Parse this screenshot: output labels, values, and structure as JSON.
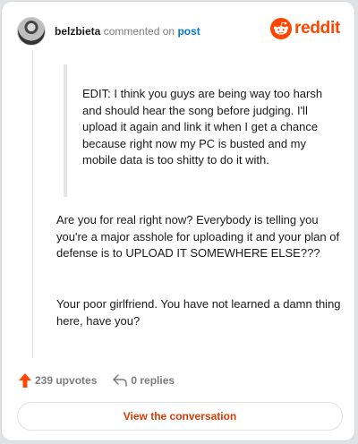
{
  "comment": {
    "author": "belzbieta",
    "action": "commented on",
    "target": "post",
    "quoted_text": "EDIT: I think you guys are being way too harsh and should hear the song before judging. I'll upload it again and link it when I get a chance because right now my PC is busted and my mobile data is too shitty to do it with.",
    "paragraphs": [
      "Are you for real right now? Everybody is telling you you're a major asshole for uploading it and your plan of defense is to UPLOAD IT SOMEWHERE ELSE???",
      "Your poor girlfriend. You have not learned a damn thing here, have you?"
    ]
  },
  "brand": {
    "name": "reddit",
    "color": "#ff4500"
  },
  "footer": {
    "upvotes": "239 upvotes",
    "replies": "0 replies",
    "view_button": "View the conversation"
  },
  "colors": {
    "upvote_arrow": "#ff4500",
    "link": "#0079d3",
    "button_text": "#d93a00"
  },
  "icons": [
    "avatar",
    "reddit-logo-icon",
    "upvote-arrow-icon",
    "reply-icon"
  ]
}
